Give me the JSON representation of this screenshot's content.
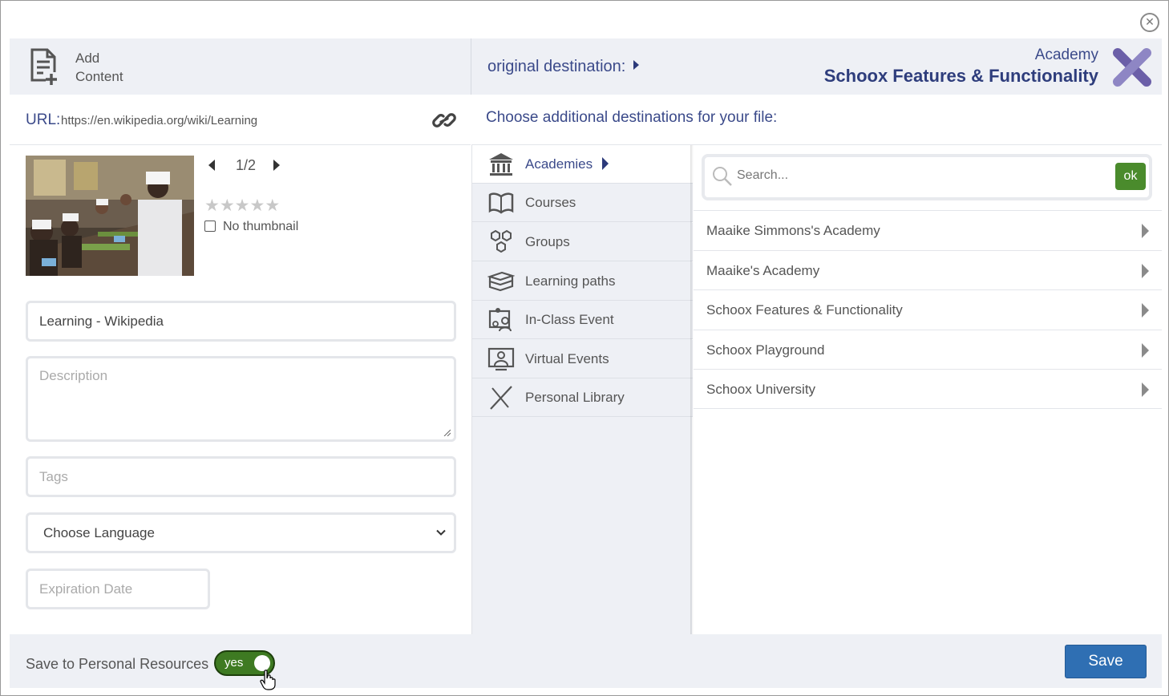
{
  "header": {
    "add_content_line1": "Add",
    "add_content_line2": "Content",
    "original_destination": "original destination:",
    "academy_label": "Academy",
    "academy_name": "Schoox Features & Functionality"
  },
  "url": {
    "label": "URL:",
    "value": "https://en.wikipedia.org/wiki/Learning"
  },
  "thumbnail": {
    "pager": "1/2",
    "rating_stars": 0,
    "max_stars": 5,
    "no_thumbnail_label": "No thumbnail"
  },
  "form": {
    "title_value": "Learning - Wikipedia",
    "description_placeholder": "Description",
    "tags_placeholder": "Tags",
    "language_selected": "Choose Language",
    "expiration_placeholder": "Expiration Date"
  },
  "destinations": {
    "heading": "Choose additional destinations for your file:",
    "nav": [
      {
        "label": "Academies",
        "icon": "academy-building-icon"
      },
      {
        "label": "Courses",
        "icon": "open-book-icon"
      },
      {
        "label": "Groups",
        "icon": "hexagons-icon"
      },
      {
        "label": "Learning paths",
        "icon": "book-stack-icon"
      },
      {
        "label": "In-Class Event",
        "icon": "classroom-icon"
      },
      {
        "label": "Virtual Events",
        "icon": "webinar-icon"
      },
      {
        "label": "Personal Library",
        "icon": "personal-library-icon"
      }
    ],
    "search_placeholder": "Search...",
    "ok_label": "ok",
    "list": [
      "Maaike Simmons's Academy",
      "Maaike's Academy",
      "Schoox Features & Functionality",
      "Schoox Playground",
      "Schoox University"
    ]
  },
  "footer": {
    "save_personal_label": "Save to Personal Resources",
    "toggle_label": "yes",
    "toggle_on": true,
    "save_label": "Save"
  },
  "colors": {
    "accent_blue": "#2f6fb3",
    "heading_blue": "#3b4a8a",
    "ok_green": "#4a8b2c",
    "panel_bg": "#eef0f5"
  }
}
